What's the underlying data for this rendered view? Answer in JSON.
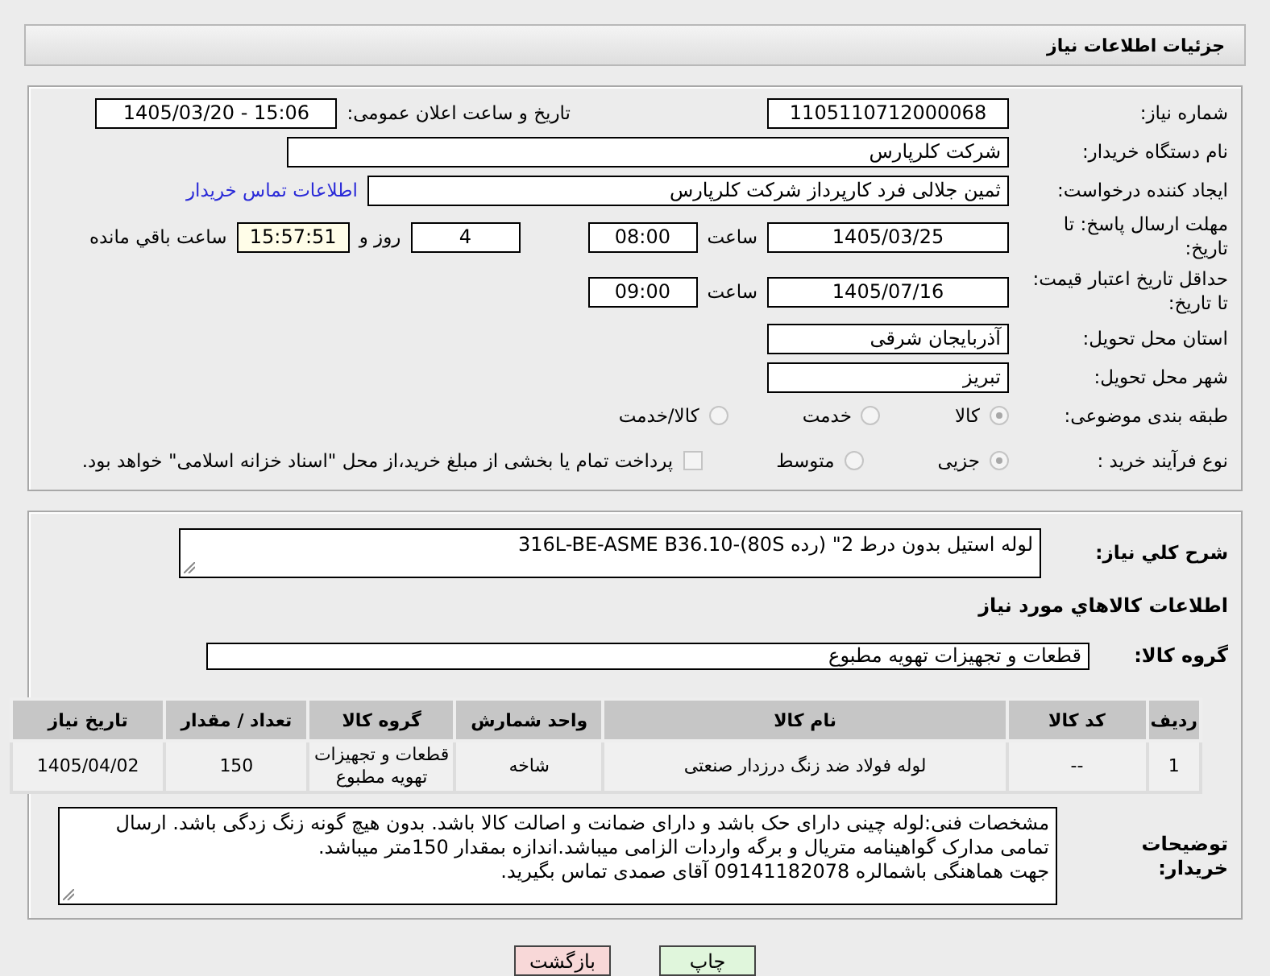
{
  "page_title": "جزئیات اطلاعات نیاز",
  "need_number": {
    "label": "شماره نیاز:",
    "value": "1105110712000068"
  },
  "announce": {
    "label": "تاریخ و ساعت اعلان عمومی:",
    "value": "1405/03/20 - 15:06"
  },
  "buyer_org": {
    "label": "نام دستگاه خریدار:",
    "value": "شرکت کلرپارس"
  },
  "requester": {
    "label": "ایجاد کننده درخواست:",
    "value": "ثمین جلالی فرد کارپرداز شرکت کلرپارس",
    "link": "اطلاعات تماس خریدار"
  },
  "reply_deadline": {
    "label": "مهلت ارسال پاسخ: تا تاریخ:",
    "date": "1405/03/25",
    "time_label": "ساعت",
    "time": "08:00",
    "days": "4",
    "days_label": "روز و",
    "remaining": "15:57:51",
    "remaining_label": "ساعت باقي مانده"
  },
  "price_validity": {
    "label": "حداقل تاریخ اعتبار قیمت: تا تاریخ:",
    "date": "1405/07/16",
    "time_label": "ساعت",
    "time": "09:00"
  },
  "province": {
    "label": "استان محل تحویل:",
    "value": "آذربایجان شرقی"
  },
  "city": {
    "label": "شهر محل تحویل:",
    "value": "تبریز"
  },
  "category": {
    "label": "طبقه بندی موضوعی:",
    "options": [
      {
        "label": "کالا",
        "selected": true
      },
      {
        "label": "خدمت",
        "selected": false
      },
      {
        "label": "کالا/خدمت",
        "selected": false
      }
    ]
  },
  "purchase_type": {
    "label": "نوع فرآیند خرید :",
    "options": [
      {
        "label": "جزیی",
        "selected": true
      },
      {
        "label": "متوسط",
        "selected": false
      }
    ],
    "payment": {
      "label": "پرداخت تمام یا بخشی از مبلغ خرید،از محل \"اسناد خزانه اسلامی\" خواهد بود.",
      "checked": false
    }
  },
  "description": {
    "label": "شرح کلي نیاز:",
    "value": "لوله استیل بدون درط 2\" (رده 80S)-316L-BE-ASME B36.10"
  },
  "goods_title": "اطلاعات کالاهاي مورد نیاز",
  "goods_group": {
    "label": "گروه کالا:",
    "value": "قطعات و تجهیزات تهویه مطبوع"
  },
  "table": {
    "columns": [
      "ردیف",
      "کد کالا",
      "نام کالا",
      "واحد شمارش",
      "گروه کالا",
      "تعداد / مقدار",
      "تاریخ نیاز"
    ],
    "rows": [
      [
        "1",
        "--",
        "لوله فولاد ضد زنگ درزدار صنعتی",
        "شاخه",
        "قطعات و تجهیزات تهویه مطبوع",
        "150",
        "1405/04/02"
      ]
    ]
  },
  "buyer_notes": {
    "label": "توضیحات خریدار:",
    "paragraphs": [
      "مشخصات فنی:لوله چینی دارای حک باشد و دارای ضمانت و اصالت کالا باشد. بدون هیچ گونه زنگ زدگی باشد. ارسال تمامی مدارک گواهینامه متریال و برگه واردات الزامی میباشد.اندازه بمقدار 150متر میباشد.",
      "جهت هماهنگی باشمالره 09141182078 آقای صمدی تماس بگیرید."
    ]
  },
  "buttons": [
    {
      "label": "چاپ",
      "kind": "print"
    },
    {
      "label": "بازگشت",
      "kind": "back"
    }
  ]
}
